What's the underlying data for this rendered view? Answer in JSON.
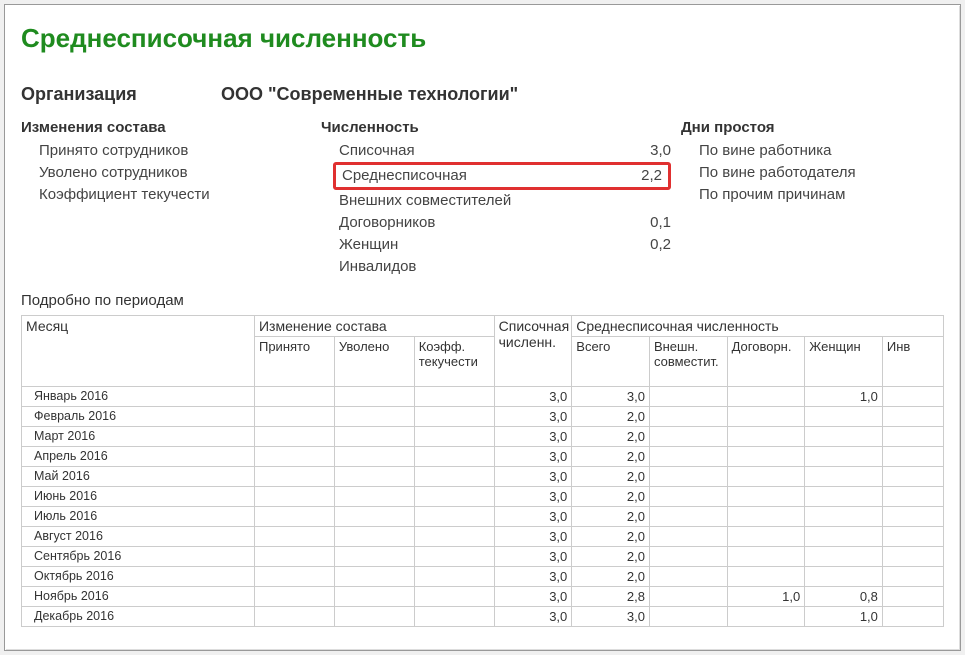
{
  "title": "Среднесписочная численность",
  "org_label": "Организация",
  "org_value": "ООО \"Современные технологии\"",
  "summary": {
    "col1": {
      "title": "Изменения состава",
      "items": [
        {
          "label": "Принято сотрудников",
          "val": ""
        },
        {
          "label": "Уволено сотрудников",
          "val": ""
        },
        {
          "label": "Коэффициент текучести",
          "val": ""
        }
      ]
    },
    "col2": {
      "title": "Численность",
      "items": [
        {
          "label": "Списочная",
          "val": "3,0"
        },
        {
          "label": "Среднесписочная",
          "val": "2,2",
          "hl": true
        },
        {
          "label": "Внешних совместителей",
          "val": ""
        },
        {
          "label": "Договорников",
          "val": "0,1"
        },
        {
          "label": "Женщин",
          "val": "0,2"
        },
        {
          "label": "Инвалидов",
          "val": ""
        }
      ]
    },
    "col3": {
      "title": "Дни простоя",
      "items": [
        {
          "label": "По вине работника",
          "val": ""
        },
        {
          "label": "По вине работодателя",
          "val": ""
        },
        {
          "label": "По прочим причинам",
          "val": ""
        }
      ]
    }
  },
  "detail_title": "Подробно по периодам",
  "table": {
    "headers": {
      "month": "Месяц",
      "change": "Изменение состава",
      "list": "Списочная численн.",
      "avg": "Среднесписочная численность",
      "sub": {
        "hired": "Принято",
        "fired": "Уволено",
        "coef": "Коэфф. текучести",
        "total": "Всего",
        "ext": "Внешн. совместит.",
        "contr": "Договорн.",
        "women": "Женщин",
        "inv": "Инв"
      }
    },
    "rows": [
      {
        "m": "Январь 2016",
        "h": "",
        "f": "",
        "c": "",
        "l": "3,0",
        "t": "3,0",
        "e": "",
        "d": "",
        "w": "1,0",
        "i": ""
      },
      {
        "m": "Февраль 2016",
        "h": "",
        "f": "",
        "c": "",
        "l": "3,0",
        "t": "2,0",
        "e": "",
        "d": "",
        "w": "",
        "i": ""
      },
      {
        "m": "Март 2016",
        "h": "",
        "f": "",
        "c": "",
        "l": "3,0",
        "t": "2,0",
        "e": "",
        "d": "",
        "w": "",
        "i": ""
      },
      {
        "m": "Апрель 2016",
        "h": "",
        "f": "",
        "c": "",
        "l": "3,0",
        "t": "2,0",
        "e": "",
        "d": "",
        "w": "",
        "i": ""
      },
      {
        "m": "Май 2016",
        "h": "",
        "f": "",
        "c": "",
        "l": "3,0",
        "t": "2,0",
        "e": "",
        "d": "",
        "w": "",
        "i": ""
      },
      {
        "m": "Июнь 2016",
        "h": "",
        "f": "",
        "c": "",
        "l": "3,0",
        "t": "2,0",
        "e": "",
        "d": "",
        "w": "",
        "i": ""
      },
      {
        "m": "Июль 2016",
        "h": "",
        "f": "",
        "c": "",
        "l": "3,0",
        "t": "2,0",
        "e": "",
        "d": "",
        "w": "",
        "i": ""
      },
      {
        "m": "Август 2016",
        "h": "",
        "f": "",
        "c": "",
        "l": "3,0",
        "t": "2,0",
        "e": "",
        "d": "",
        "w": "",
        "i": ""
      },
      {
        "m": "Сентябрь 2016",
        "h": "",
        "f": "",
        "c": "",
        "l": "3,0",
        "t": "2,0",
        "e": "",
        "d": "",
        "w": "",
        "i": ""
      },
      {
        "m": "Октябрь 2016",
        "h": "",
        "f": "",
        "c": "",
        "l": "3,0",
        "t": "2,0",
        "e": "",
        "d": "",
        "w": "",
        "i": ""
      },
      {
        "m": "Ноябрь 2016",
        "h": "",
        "f": "",
        "c": "",
        "l": "3,0",
        "t": "2,8",
        "e": "",
        "d": "1,0",
        "w": "0,8",
        "i": ""
      },
      {
        "m": "Декабрь 2016",
        "h": "",
        "f": "",
        "c": "",
        "l": "3,0",
        "t": "3,0",
        "e": "",
        "d": "",
        "w": "1,0",
        "i": ""
      }
    ]
  }
}
